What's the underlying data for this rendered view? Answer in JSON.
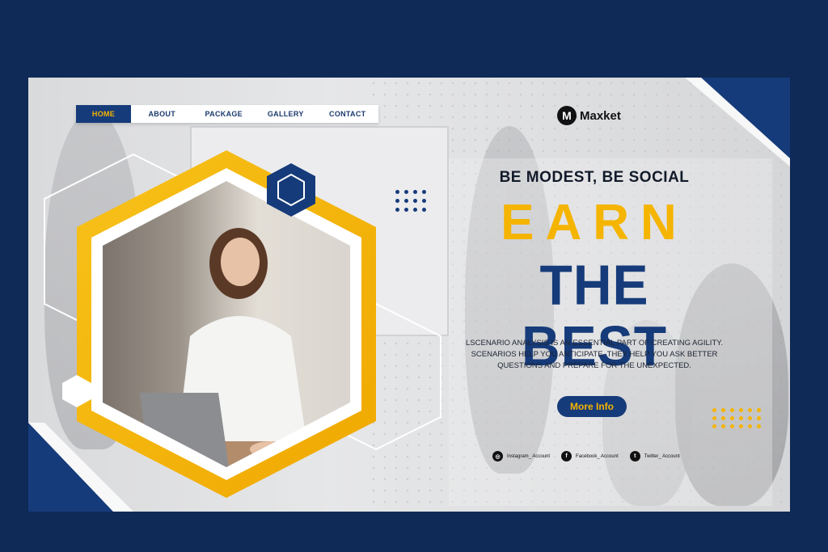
{
  "nav": {
    "items": [
      {
        "label": "HOME",
        "active": true
      },
      {
        "label": "ABOUT",
        "active": false
      },
      {
        "label": "PACKAGE",
        "active": false
      },
      {
        "label": "GALLERY",
        "active": false
      },
      {
        "label": "CONTACT",
        "active": false
      }
    ]
  },
  "logo": {
    "mark": "M",
    "text": "Maxket"
  },
  "hero": {
    "tagline": "BE MODEST, BE SOCIAL",
    "headline_1": "EARN",
    "headline_2": "THE BEST",
    "description": "LSCENARIO ANALYSIS IS AN ESSENTIAL PART OF CREATING AGILITY. SCENARIOS HELP YOU ANTICIPATE. THEY HELP YOU ASK BETTER QUESTIONS AND PREPARE FOR THE UNEXPECTED.",
    "cta_label": "More Info"
  },
  "socials": [
    {
      "icon": "instagram-icon",
      "glyph": "◎",
      "label": "Instagram_ Account"
    },
    {
      "icon": "facebook-icon",
      "glyph": "f",
      "label": "Facebook_ Account"
    },
    {
      "icon": "twitter-icon",
      "glyph": "t",
      "label": "Twitter_ Account"
    }
  ],
  "colors": {
    "background": "#0f2a57",
    "primary": "#163b7a",
    "accent": "#f5b400",
    "text_dark": "#121a2a"
  }
}
